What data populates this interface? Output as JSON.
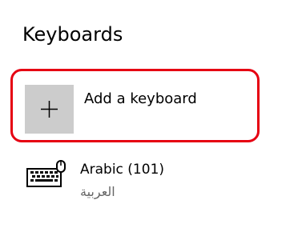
{
  "section": {
    "title": "Keyboards"
  },
  "add_keyboard": {
    "label": "Add a keyboard",
    "icon": "plus-icon"
  },
  "keyboards": [
    {
      "name": "Arabic (101)",
      "native_name": "العربية",
      "icon": "keyboard-icon"
    }
  ],
  "colors": {
    "highlight": "#e60012",
    "tile": "#cccccc",
    "secondary_text": "#666666"
  }
}
